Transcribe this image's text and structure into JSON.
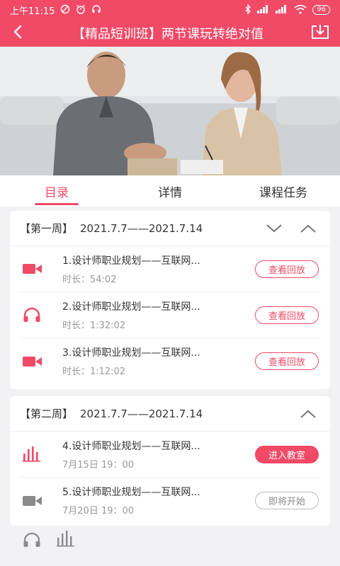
{
  "status_bar": {
    "time": "上午11:15",
    "battery": "96"
  },
  "app_bar": {
    "title": "【精品短训班】两节课玩转绝对值"
  },
  "tabs": [
    {
      "label": "目录"
    },
    {
      "label": "详情"
    },
    {
      "label": "课程任务"
    }
  ],
  "weeks": [
    {
      "title": "【第一周】",
      "dates": "2021.7.7——2021.7.14",
      "lessons": [
        {
          "title": "1.设计师职业规划——互联网...",
          "sub": "时长：54:02",
          "action": "查看回放",
          "icon": "video-camera-icon"
        },
        {
          "title": "2.设计师职业规划——互联网...",
          "sub": "时长：1:32:02",
          "action": "查看回放",
          "icon": "headphones-icon"
        },
        {
          "title": "3.设计师职业规划——互联网...",
          "sub": "时长：1:12:02",
          "action": "查看回放",
          "icon": "video-camera-icon"
        }
      ]
    },
    {
      "title": "【第二周】",
      "dates": "2021.7.7——2021.7.14",
      "lessons": [
        {
          "title": "4.设计师职业规划——互联网...",
          "sub": "7月15日 19：00",
          "action": "进入教室",
          "icon": "live-bars-icon"
        },
        {
          "title": "5.设计师职业规划——互联网...",
          "sub": "7月20日 19：00",
          "action": "即将开始",
          "icon": "video-camera-icon"
        }
      ]
    }
  ],
  "colors": {
    "accent": "#f04a67",
    "muted_icon": "#8a8a8a"
  }
}
